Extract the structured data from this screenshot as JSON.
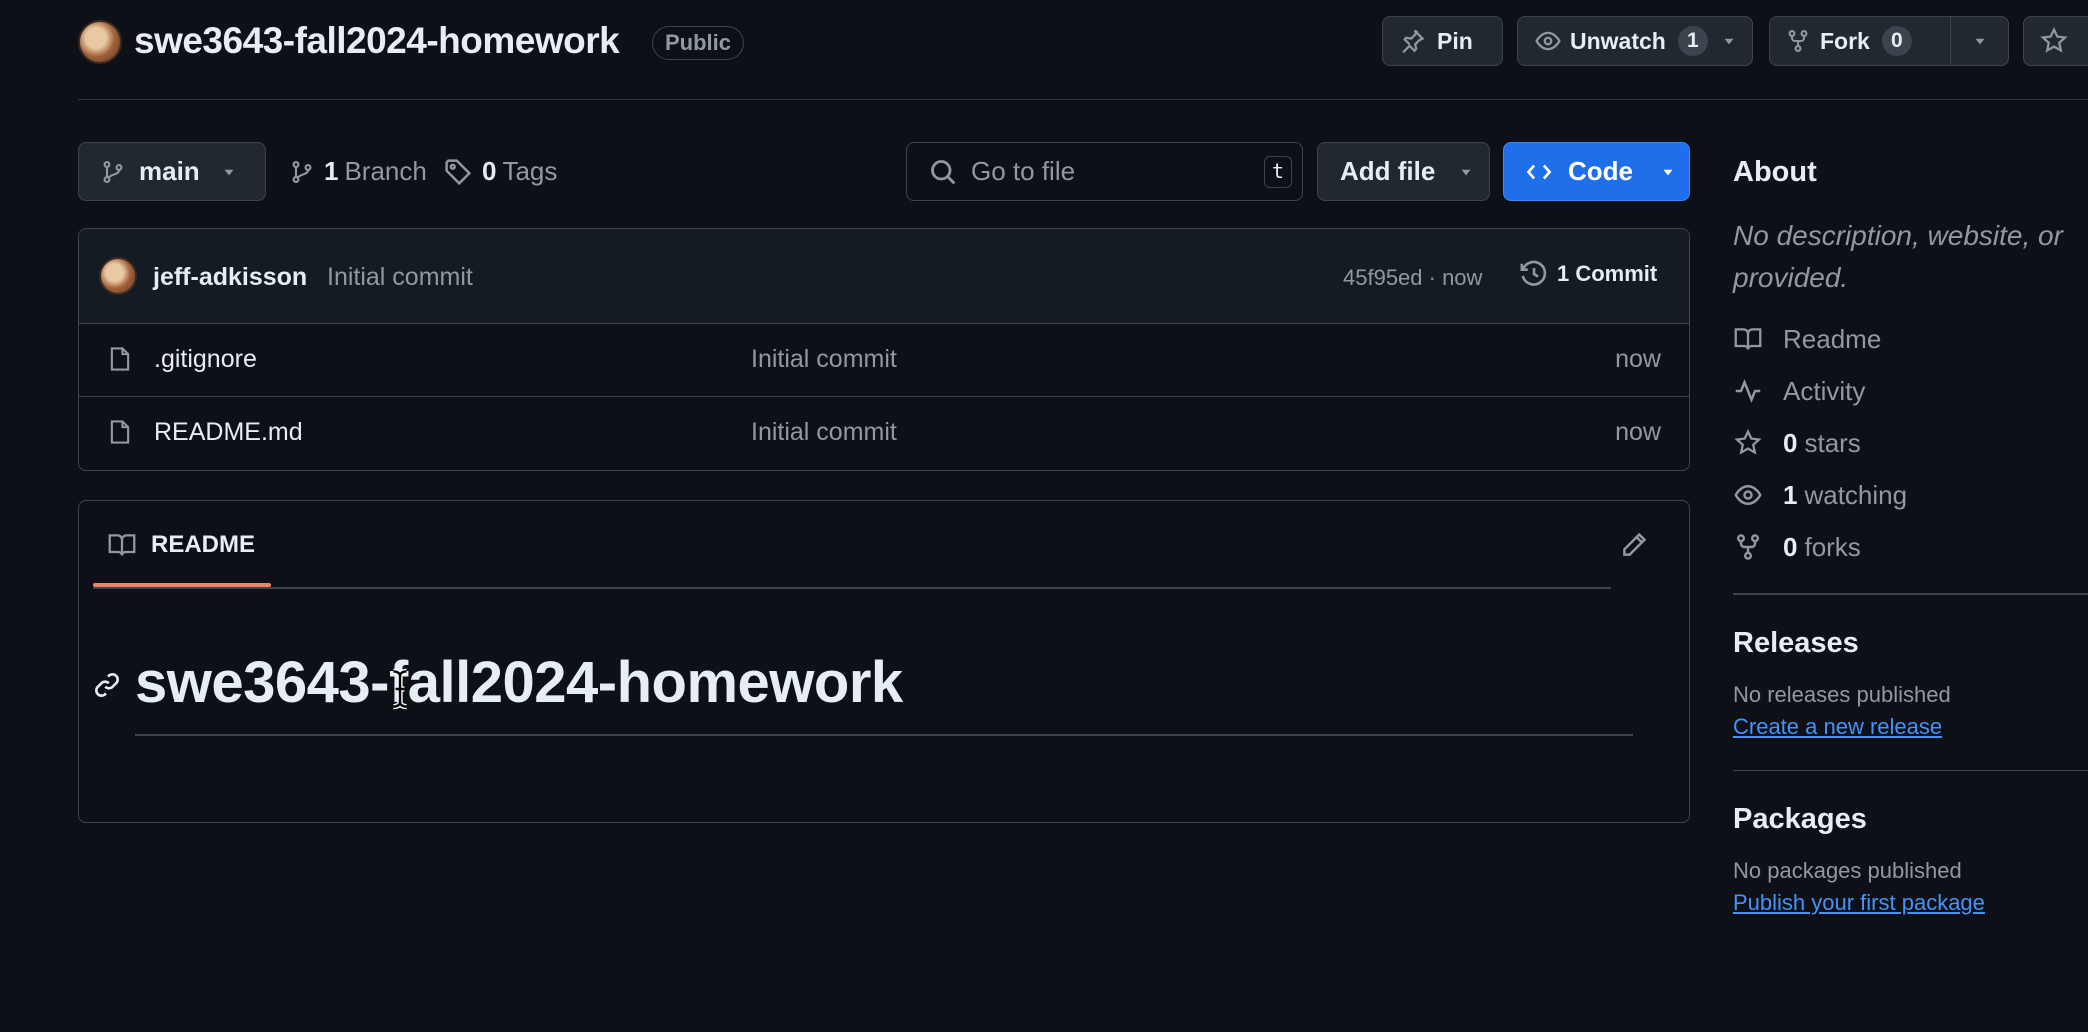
{
  "header": {
    "repo_name": "swe3643-fall2024-homework",
    "visibility": "Public",
    "pin_label": "Pin",
    "unwatch_label": "Unwatch",
    "unwatch_count": "1",
    "fork_label": "Fork",
    "fork_count": "0"
  },
  "toolbar": {
    "branch": "main",
    "branch_count": "1",
    "branch_label": "Branch",
    "tag_count": "0",
    "tag_label": "Tags",
    "search_placeholder": "Go to file",
    "search_shortcut": "t",
    "add_file_label": "Add file",
    "code_label": "Code"
  },
  "latest_commit": {
    "author": "jeff-adkisson",
    "message": "Initial commit",
    "hash_time": "45f95ed · now",
    "commits_label": "1 Commit"
  },
  "files": [
    {
      "name": ".gitignore",
      "message": "Initial commit",
      "time": "now"
    },
    {
      "name": "README.md",
      "message": "Initial commit",
      "time": "now"
    }
  ],
  "readme": {
    "tab_label": "README",
    "heading": "swe3643-fall2024-homework"
  },
  "sidebar": {
    "about_title": "About",
    "description_line1": "No description, website, or",
    "description_line2": "provided.",
    "readme_label": "Readme",
    "activity_label": "Activity",
    "stars_count": "0",
    "stars_label": "stars",
    "watching_count": "1",
    "watching_label": "watching",
    "forks_count": "0",
    "forks_label": "forks",
    "releases_title": "Releases",
    "releases_empty": "No releases published",
    "releases_link": "Create a new release",
    "packages_title": "Packages",
    "packages_empty": "No packages published",
    "packages_link": "Publish your first package"
  },
  "colors": {
    "background": "#0d1117",
    "border": "#3d444d",
    "accent_blue": "#1f6feb",
    "link": "#4493f8",
    "tab_underline": "#f78166"
  }
}
